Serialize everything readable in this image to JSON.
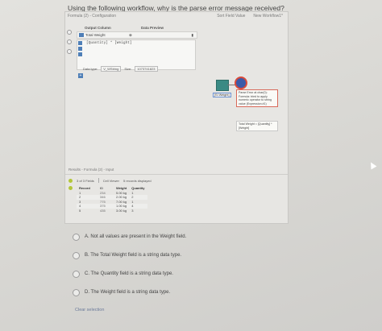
{
  "question": "Using the following workflow, why is the parse error message received?",
  "config_panel": {
    "tabs": [
      "Formula (2) - Configuration"
    ],
    "right_tabs": [
      "Sort Field Value",
      "New Workflow1*"
    ],
    "col_output": "Output Column",
    "col_preview": "Data Preview",
    "rows": [
      {
        "name": "Total Weight",
        "preview": ""
      },
      {
        "name": "[Quantity] * [Weight]",
        "preview": ""
      }
    ],
    "data_type_label": "Data type:",
    "data_type_value": "V_WString",
    "size_label": "Size:",
    "size_value": "1073741823",
    "add_button": "+"
  },
  "canvas": {
    "tool_left_label": "[SI Weight]",
    "annotation": "Parse Error at char(0): Formula: tried to apply numeric operator to string value (Expression #1)",
    "annotation2": "Total Weight = [Quantity] * [Weight]"
  },
  "results": {
    "header": "Results - Formula (2) - Input",
    "toolbar": {
      "fields": "3 of 3 Fields",
      "cell_viewer": "Cell Viewer",
      "records_displayed": "5 records displayed"
    },
    "columns": [
      "Record",
      "ID",
      "Weight",
      "Quantity"
    ],
    "rows": [
      [
        "1",
        "234",
        "5.00 kg",
        "1"
      ],
      [
        "2",
        "346",
        "2.00 kg",
        "2"
      ],
      [
        "3",
        "775",
        "7.00 kg",
        "1"
      ],
      [
        "4",
        "375",
        "1.00 kg",
        "4"
      ],
      [
        "5",
        "435",
        "3.00 kg",
        "3"
      ]
    ]
  },
  "options": [
    "A. Not all values are present in the Weight field.",
    "B. The Total Weight field is a string data type.",
    "C. The Quantity field is a string data type.",
    "D. The Weight field is a string data type."
  ],
  "clear_label": "Clear selection"
}
